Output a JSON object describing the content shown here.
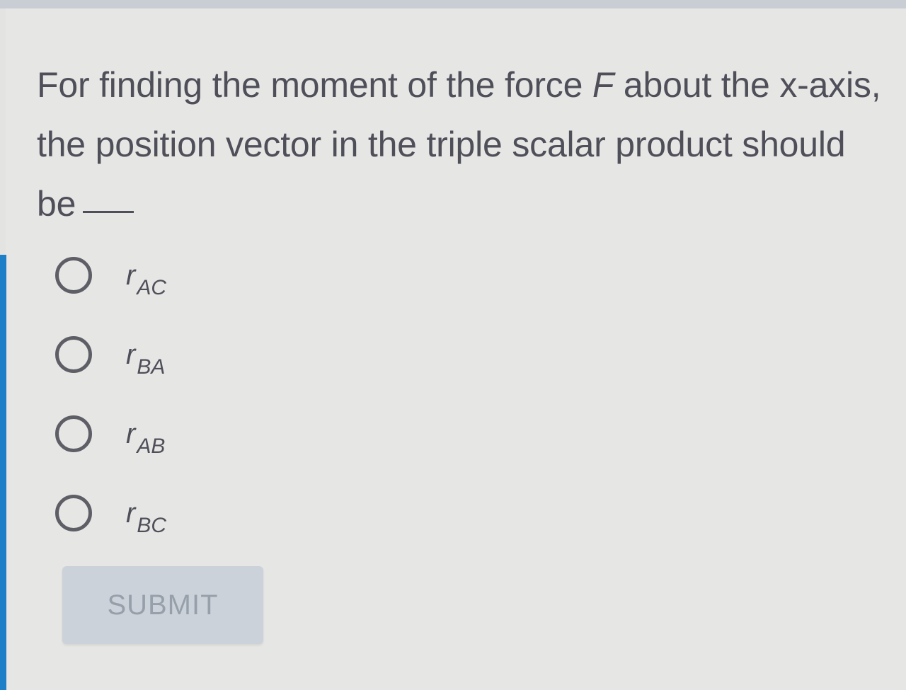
{
  "question": {
    "text_before": "For finding the moment of the force ",
    "variable": "F",
    "text_after": " about the x-axis, the position vector in the triple scalar product should be"
  },
  "options": [
    {
      "symbol": "r",
      "subscript": "AC"
    },
    {
      "symbol": "r",
      "subscript": "BA"
    },
    {
      "symbol": "r",
      "subscript": "AB"
    },
    {
      "symbol": "r",
      "subscript": "BC"
    }
  ],
  "submit": {
    "label": "SUBMIT",
    "enabled": false
  },
  "colors": {
    "accent": "#1c7fc8",
    "text": "#4f4f5a",
    "button_disabled_bg": "#ccd2d9",
    "button_disabled_text": "#97a0aa"
  }
}
